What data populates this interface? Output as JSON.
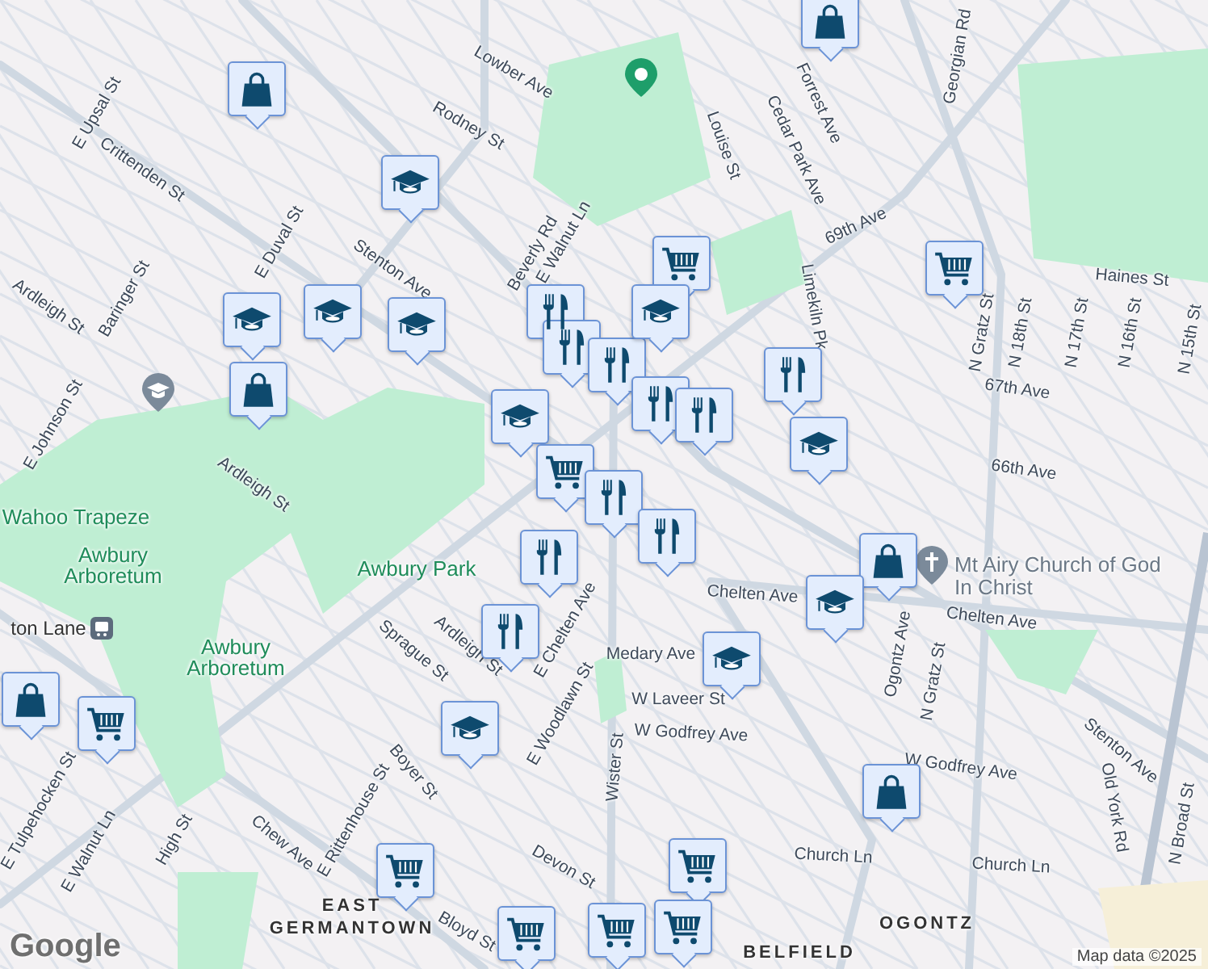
{
  "map": {
    "labels": [
      {
        "text": "Rodney St",
        "kind": "street"
      },
      {
        "text": "Lowber Ave",
        "kind": "street"
      },
      {
        "text": "E Upsal St",
        "kind": "street"
      },
      {
        "text": "Crittenden St",
        "kind": "street"
      },
      {
        "text": "E Duval St",
        "kind": "street"
      },
      {
        "text": "Baringer St",
        "kind": "street"
      },
      {
        "text": "Ardleigh St",
        "kind": "street"
      },
      {
        "text": "Stenton Ave",
        "kind": "street"
      },
      {
        "text": "Beverly Rd",
        "kind": "street"
      },
      {
        "text": "E Walnut Ln",
        "kind": "street"
      },
      {
        "text": "E Johnson St",
        "kind": "street"
      },
      {
        "text": "Ardleigh St",
        "kind": "street"
      },
      {
        "text": "Wahoo Trapeze",
        "kind": "park"
      },
      {
        "text": "Awbury Arboretum",
        "kind": "park"
      },
      {
        "text": "Awbury Park",
        "kind": "park"
      },
      {
        "text": "Awbury Arboretum",
        "kind": "park"
      },
      {
        "text": "Louise St",
        "kind": "street"
      },
      {
        "text": "Cedar Park Ave",
        "kind": "street"
      },
      {
        "text": "Forrest Ave",
        "kind": "street"
      },
      {
        "text": "Georgian Rd",
        "kind": "street"
      },
      {
        "text": "69th Ave",
        "kind": "street"
      },
      {
        "text": "Limekiln Pk",
        "kind": "street"
      },
      {
        "text": "Haines St",
        "kind": "street"
      },
      {
        "text": "N Gratz St",
        "kind": "street"
      },
      {
        "text": "N 18th St",
        "kind": "street"
      },
      {
        "text": "N 17th St",
        "kind": "street"
      },
      {
        "text": "N 16th St",
        "kind": "street"
      },
      {
        "text": "N 15th St",
        "kind": "street"
      },
      {
        "text": "67th Ave",
        "kind": "street"
      },
      {
        "text": "66th Ave",
        "kind": "street"
      },
      {
        "text": "Chelten Ave",
        "kind": "street"
      },
      {
        "text": "Chelten Ave",
        "kind": "street"
      },
      {
        "text": "Mt Airy Church of God In Christ",
        "kind": "place"
      },
      {
        "text": "Ogontz Ave",
        "kind": "street"
      },
      {
        "text": "N Gratz St",
        "kind": "street"
      },
      {
        "text": "Medary Ave",
        "kind": "street"
      },
      {
        "text": "W Laveer St",
        "kind": "street"
      },
      {
        "text": "W Godfrey Ave",
        "kind": "street"
      },
      {
        "text": "W Godfrey Ave",
        "kind": "street"
      },
      {
        "text": "Wister St",
        "kind": "street"
      },
      {
        "text": "Church Ln",
        "kind": "street"
      },
      {
        "text": "Church Ln",
        "kind": "street"
      },
      {
        "text": "Old York Rd",
        "kind": "street"
      },
      {
        "text": "Stenton Ave",
        "kind": "street"
      },
      {
        "text": "N Broad St",
        "kind": "street"
      },
      {
        "text": "OGONTZ",
        "kind": "area"
      },
      {
        "text": "BELFIELD",
        "kind": "area"
      },
      {
        "text": "EAST GERMANTOWN",
        "kind": "area"
      },
      {
        "text": "Chew Ave",
        "kind": "street"
      },
      {
        "text": "High St",
        "kind": "street"
      },
      {
        "text": "E Walnut Ln",
        "kind": "street"
      },
      {
        "text": "E Tulpehocken St",
        "kind": "street"
      },
      {
        "text": "E Rittenhouse St",
        "kind": "street"
      },
      {
        "text": "Boyer St",
        "kind": "street"
      },
      {
        "text": "Sprague St",
        "kind": "street"
      },
      {
        "text": "Ardleigh St",
        "kind": "street"
      },
      {
        "text": "E Chelten Ave",
        "kind": "street"
      },
      {
        "text": "E Woodlawn St",
        "kind": "street"
      },
      {
        "text": "Devon St",
        "kind": "street"
      },
      {
        "text": "Bloyd St",
        "kind": "street"
      },
      {
        "text": "ton Lane",
        "kind": "station"
      }
    ],
    "markers": [
      {
        "kind": "shop"
      },
      {
        "kind": "school"
      },
      {
        "kind": "school"
      },
      {
        "kind": "school"
      },
      {
        "kind": "school"
      },
      {
        "kind": "shop"
      },
      {
        "kind": "restaurant"
      },
      {
        "kind": "restaurant"
      },
      {
        "kind": "restaurant"
      },
      {
        "kind": "restaurant"
      },
      {
        "kind": "restaurant"
      },
      {
        "kind": "grocery"
      },
      {
        "kind": "school"
      },
      {
        "kind": "school"
      },
      {
        "kind": "grocery"
      },
      {
        "kind": "restaurant"
      },
      {
        "kind": "restaurant"
      },
      {
        "kind": "restaurant"
      },
      {
        "kind": "restaurant"
      },
      {
        "kind": "restaurant"
      },
      {
        "kind": "school"
      },
      {
        "kind": "grocery"
      },
      {
        "kind": "shop"
      },
      {
        "kind": "shop"
      },
      {
        "kind": "grocery"
      },
      {
        "kind": "school"
      },
      {
        "kind": "grocery"
      },
      {
        "kind": "grocery"
      },
      {
        "kind": "grocery"
      },
      {
        "kind": "grocery"
      },
      {
        "kind": "grocery"
      },
      {
        "kind": "shop"
      },
      {
        "kind": "school"
      },
      {
        "kind": "school"
      },
      {
        "kind": "shop"
      }
    ],
    "attribution": "Map data ©2025",
    "logo": "Google"
  }
}
